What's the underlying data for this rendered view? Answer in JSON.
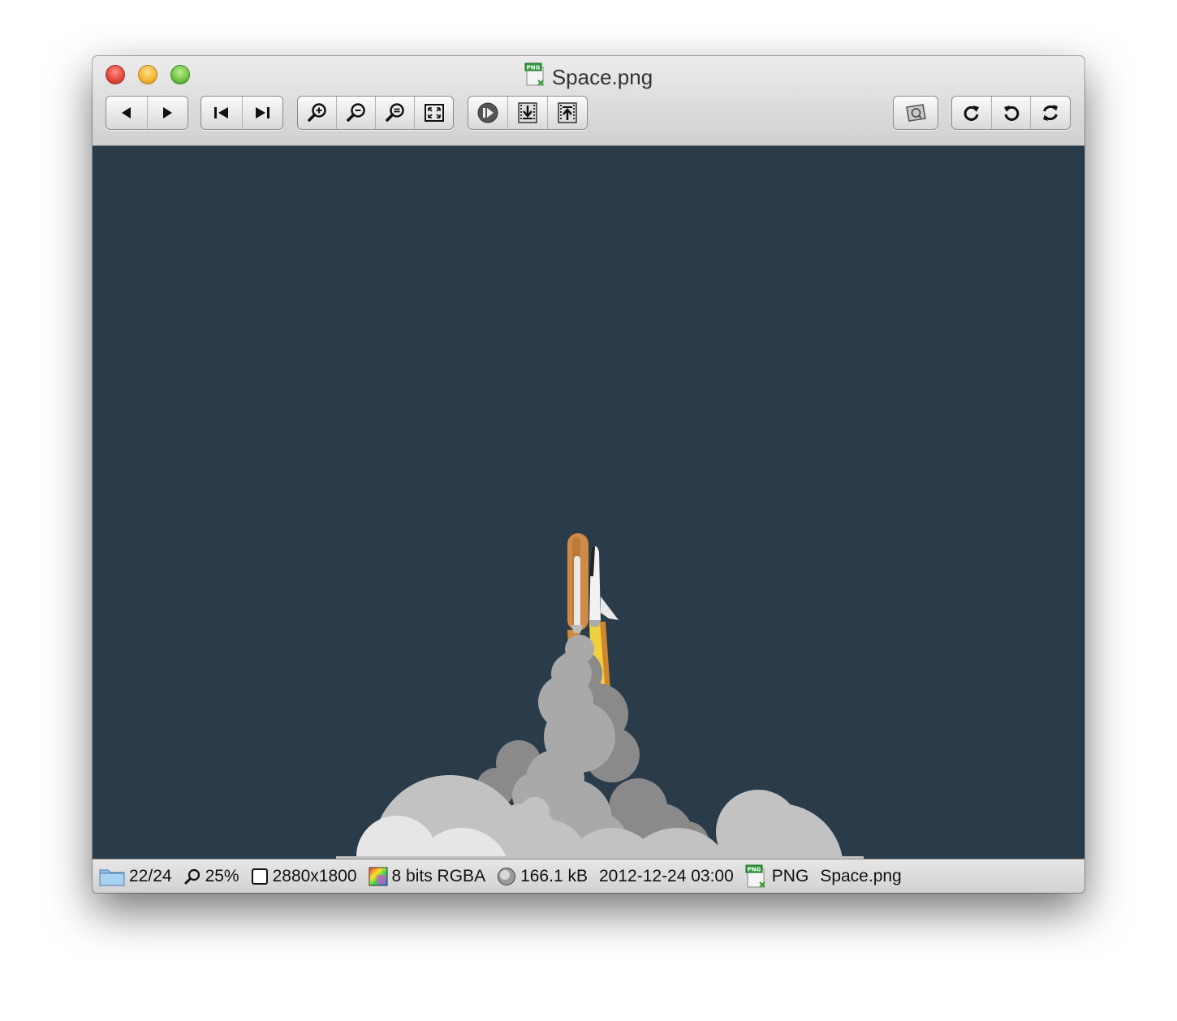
{
  "window": {
    "title": "Space.png",
    "title_icon": "png-file-icon"
  },
  "toolbar": {
    "groups": [
      {
        "name": "navigation",
        "buttons": [
          "previous-icon",
          "next-icon"
        ]
      },
      {
        "name": "first-last",
        "buttons": [
          "first-icon",
          "last-icon"
        ]
      },
      {
        "name": "zoom",
        "buttons": [
          "zoom-in-icon",
          "zoom-out-icon",
          "zoom-fit-icon",
          "fullscreen-icon"
        ]
      },
      {
        "name": "slideshow",
        "buttons": [
          "slideshow-icon",
          "frame-down-icon",
          "frame-up-icon"
        ]
      },
      {
        "name": "info",
        "buttons": [
          "info-image-icon"
        ]
      },
      {
        "name": "rotate",
        "buttons": [
          "rotate-right-icon",
          "rotate-left-icon",
          "auto-rotate-icon"
        ]
      }
    ]
  },
  "image": {
    "background": "#2a3b49",
    "subject": "space-shuttle-launch"
  },
  "status": {
    "position": "22/24",
    "zoom": "25%",
    "dimensions": "2880x1800",
    "color_depth": "8 bits RGBA",
    "file_size": "166.1 kB",
    "date": "2012-12-24 03:00",
    "format": "PNG",
    "filename": "Space.png"
  }
}
